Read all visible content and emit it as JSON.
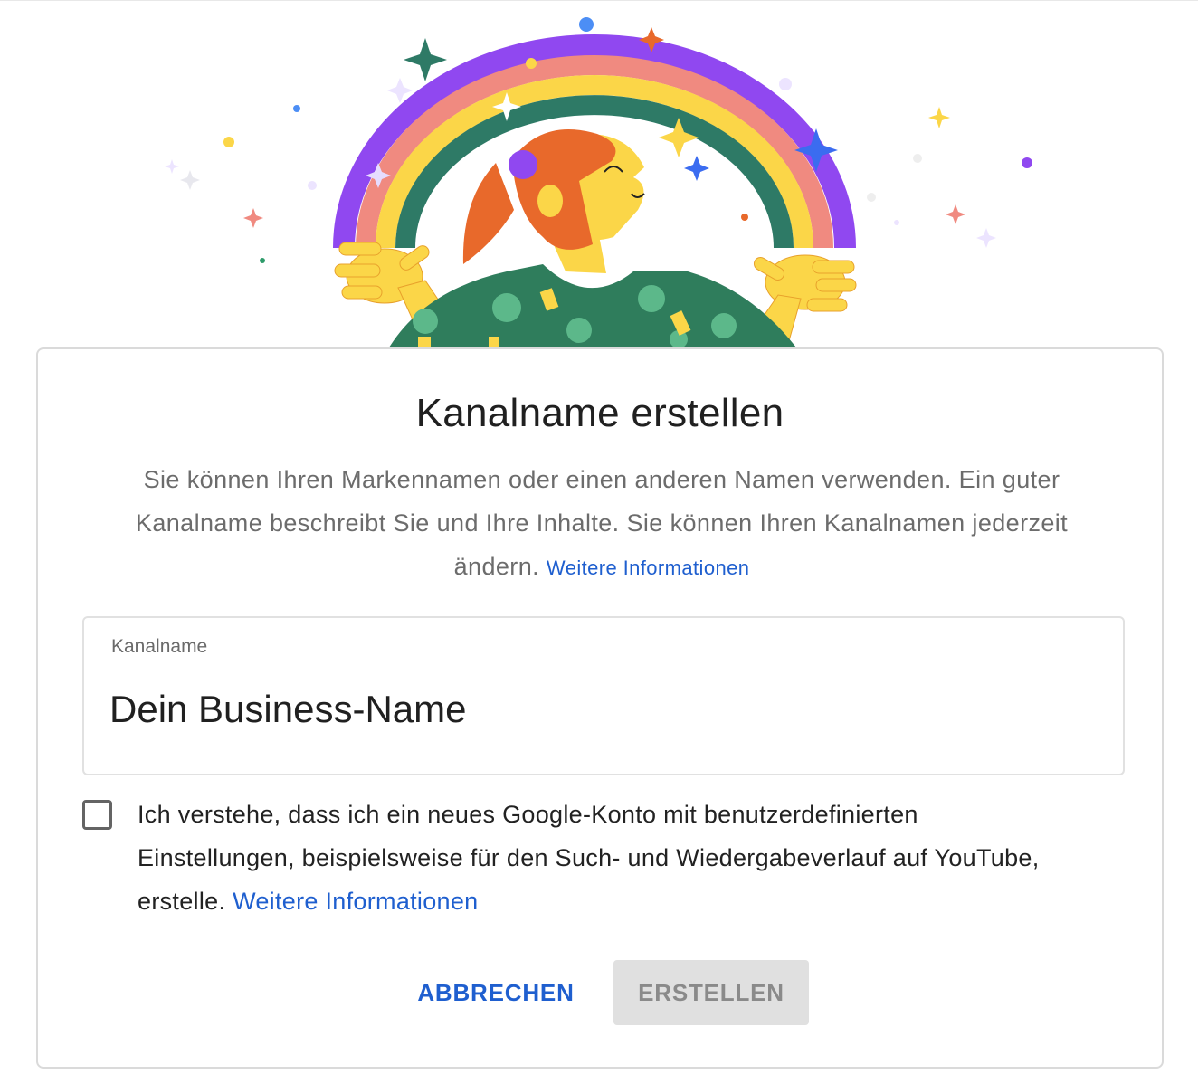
{
  "dialog": {
    "title": "Kanalname erstellen",
    "description": "Sie können Ihren Markennamen oder einen anderen Namen verwenden. Ein guter Kanalname beschreibt Sie und Ihre Inhalte. Sie können Ihren Kanalnamen jederzeit ändern.",
    "description_link": "Weitere Informationen",
    "field": {
      "label": "Kanalname",
      "value": "Dein Business-Name"
    },
    "consent": {
      "checked": false,
      "text": "Ich verstehe, dass ich ein neues Google-Konto mit benutzerdefinierten Einstellungen, beispielsweise für den Such- und Wiedergabeverlauf auf YouTube, erstelle.",
      "link": "Weitere Informationen"
    },
    "buttons": {
      "cancel": "ABBRECHEN",
      "create": "ERSTELLEN",
      "create_enabled": false
    }
  },
  "illustration": {
    "subject": "rainbow-person-illustration",
    "colors": {
      "purple": "#9048f0",
      "salmon": "#f08a80",
      "yellow": "#fbd648",
      "teal": "#2e7a66",
      "orange_hair": "#e8692b",
      "skin": "#fbd648",
      "shirt": "#2f7d5c"
    }
  },
  "colors": {
    "accent_link": "#1f5fcf",
    "disabled_button_bg": "#e0e0e0",
    "disabled_button_text": "#8a8a8a"
  }
}
